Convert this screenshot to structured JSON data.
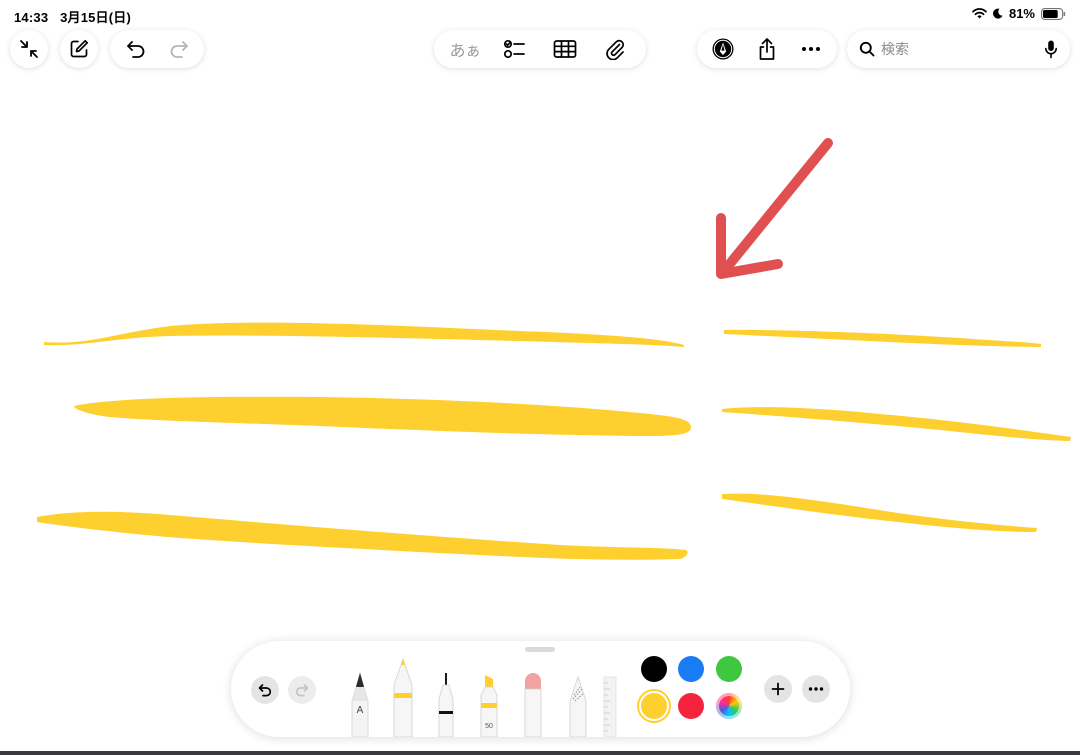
{
  "status_bar": {
    "time": "14:33",
    "date": "3月15日(日)",
    "battery_percent": "81%",
    "battery_level": 0.81,
    "icons": [
      "wifi-icon",
      "moon-icon",
      "battery-icon"
    ]
  },
  "toolbar": {
    "left_icons": [
      "collapse-arrows-icon",
      "compose-icon",
      "undo-icon",
      "redo-icon"
    ],
    "text_style_label": "あぁ",
    "center_icons": [
      "checklist-icon",
      "table-icon",
      "paperclip-icon"
    ],
    "right_icons": [
      "markup-pen-icon",
      "share-icon",
      "more-icon"
    ],
    "search_placeholder": "検索",
    "mic_icon": "microphone-icon"
  },
  "palette": {
    "pen_width_label": "50",
    "tools": [
      "pencil-a",
      "monoline-pen",
      "fineliner-pen",
      "highlighter",
      "eraser",
      "lasso",
      "ruler"
    ],
    "pen_label": "A",
    "colors": [
      {
        "name": "black",
        "hex": "#000000"
      },
      {
        "name": "blue",
        "hex": "#1a7cf5"
      },
      {
        "name": "green",
        "hex": "#3fc83f"
      },
      {
        "name": "yellow",
        "hex": "#fed02f",
        "selected": true
      },
      {
        "name": "red",
        "hex": "#f5243c"
      },
      {
        "name": "color-picker",
        "hex": "multicolor"
      }
    ],
    "highlight_color": "#fed02f",
    "arrow_color": "#e05050"
  }
}
